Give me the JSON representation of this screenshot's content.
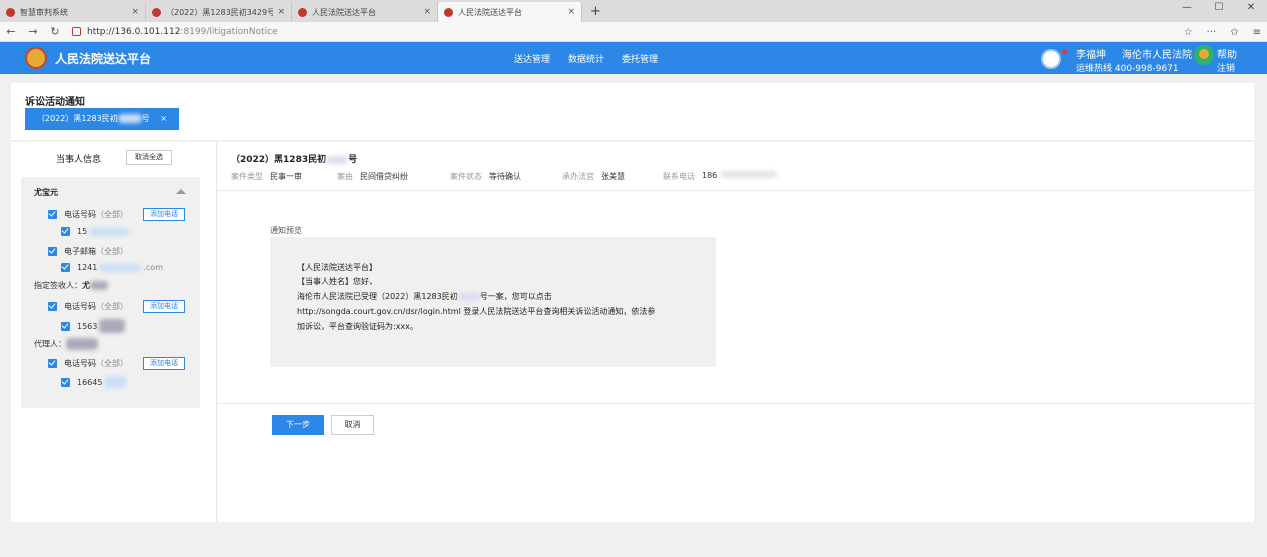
{
  "browser": {
    "tabs": [
      {
        "title": "智慧审判系统"
      },
      {
        "title": "（2022）黑1283民初3429号"
      },
      {
        "title": "人民法院送达平台"
      },
      {
        "title": "人民法院送达平台"
      }
    ],
    "new_tab": "+",
    "url_host": "http://136.0.101.112",
    "url_path": ":8199/litigationNotice"
  },
  "header": {
    "app_title": "人民法院送达平台",
    "nav": [
      "送达管理",
      "数据统计",
      "委托管理"
    ],
    "user_name": "李福坤",
    "court_name": "海伦市人民法院",
    "hotline": "运维热线 400-998-9671",
    "help": "帮助",
    "logout": "注销"
  },
  "page": {
    "title": "诉讼活动通知",
    "case_tab_prefix": "（2022）黑1283民初",
    "case_tab_suffix": "号"
  },
  "party_panel": {
    "title": "当事人信息",
    "deselect_all": "取消全选",
    "party_name": "尤宝元",
    "phone_label": "电话号码",
    "all_label": "（全部）",
    "add_phone": "添加电话",
    "phone1_prefix": "15",
    "email_label": "电子邮箱",
    "email_prefix": "1241",
    "email_suffix": ".com",
    "signee_label": "指定签收人：",
    "signee_prefix": "尤",
    "phone2_prefix": "1563",
    "agent_label": "代理人：",
    "phone3_prefix": "16645"
  },
  "case_info": {
    "heading_prefix": "（2022）黑1283民初",
    "heading_suffix": "号",
    "type_label": "案件类型",
    "type_value": "民事一审",
    "cause_label": "案由",
    "cause_value": "民间借贷纠纷",
    "status_label": "案件状态",
    "status_value": "等待确认",
    "judge_label": "承办法官",
    "judge_value": "张美慧",
    "phone_label": "联系电话",
    "phone_value": "186"
  },
  "preview": {
    "label": "通知预览",
    "line1": "【人民法院送达平台】",
    "line2": "【当事人姓名】您好，",
    "line3_a": "海伦市人民法院已受理（2022）黑1283民初",
    "line3_b": "号一案，您可以点击",
    "line4": "http://songda.court.gov.cn/dsr/login.html 登录人民法院送达平台查询相关诉讼活动通知，依法参",
    "line5": "加诉讼，平台查询验证码为:xxx。"
  },
  "actions": {
    "next": "下一步",
    "cancel": "取消"
  },
  "colors": {
    "primary": "#2d87e6",
    "help_green": "#2fb36a"
  }
}
